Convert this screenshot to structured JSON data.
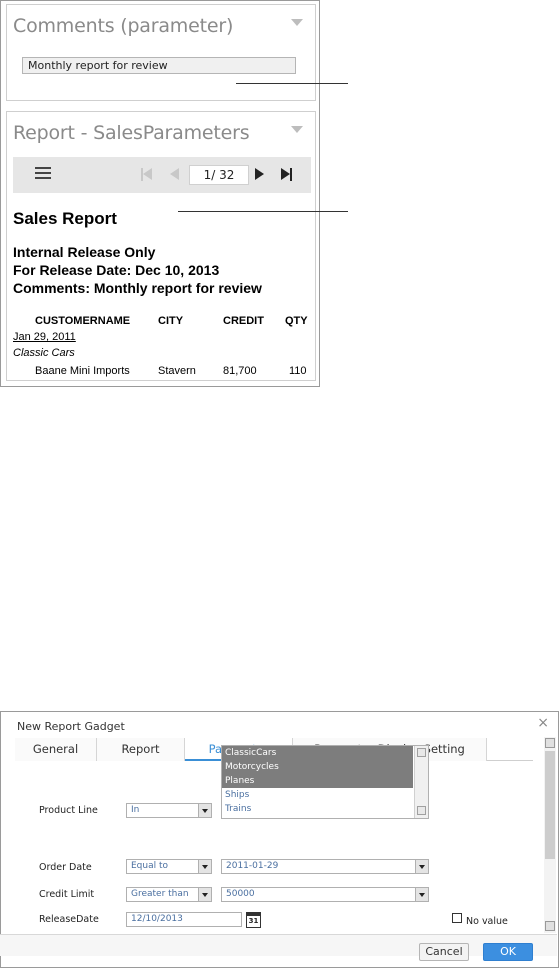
{
  "comments_gadget": {
    "title": "Comments (parameter)",
    "value": "Monthly report for review"
  },
  "report_gadget": {
    "title": "Report - SalesParameters",
    "page_current": "1",
    "page_total": "/ 32",
    "report": {
      "heading": "Sales Report",
      "line1": "Internal Release Only",
      "line2": "For Release Date: Dec 10, 2013",
      "line3": "Comments: Monthly report for review",
      "columns": [
        "CUSTOMERNAME",
        "CITY",
        "CREDIT",
        "QTY"
      ],
      "date_group": "Jan 29, 2011",
      "category_group": "Classic Cars",
      "row": [
        "Baane Mini Imports",
        "Stavern",
        "81,700",
        "110"
      ]
    }
  },
  "dialog": {
    "title": "New Report Gadget",
    "close": "×",
    "tabs": [
      "General",
      "Report",
      "Parameter",
      "Parameter Display Setting"
    ],
    "active_tab": "Parameter",
    "product_line": {
      "label": "Product Line",
      "operator": "In",
      "options": [
        "ClassicCars",
        "Motorcycles",
        "Planes",
        "Ships",
        "Trains"
      ],
      "selected": [
        "ClassicCars",
        "Motorcycles",
        "Planes"
      ]
    },
    "order_date": {
      "label": "Order Date",
      "operator": "Equal to",
      "value": "2011-01-29"
    },
    "credit_limit": {
      "label": "Credit Limit",
      "operator": "Greater than",
      "value": "50000"
    },
    "release_date": {
      "label": "ReleaseDate",
      "value": "12/10/2013",
      "calendar_day": "31",
      "no_value_label": "No value"
    },
    "cancel_label": "Cancel",
    "ok_label": "OK"
  },
  "colors": {
    "accent": "#3a8fd6",
    "selected_item": "#7d7d7d",
    "ok_button": "#3c8fe0"
  }
}
